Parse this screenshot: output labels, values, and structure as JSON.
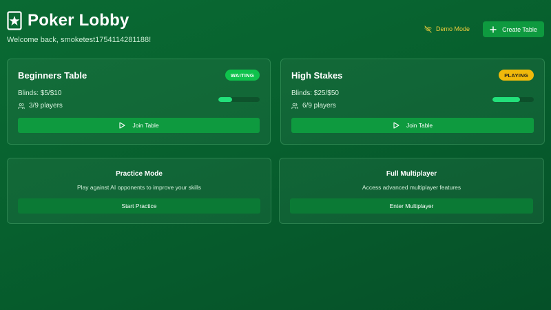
{
  "header": {
    "title": "Poker Lobby",
    "welcome": "Welcome back, smoketest1754114281188!"
  },
  "toolbar": {
    "demo_label": "Demo Mode",
    "create_label": "Create Table"
  },
  "tables": [
    {
      "name": "Beginners Table",
      "status": "WAITING",
      "status_color": "#0fc24c",
      "blinds": "Blinds: $5/$10",
      "players": "3/9 players",
      "fill_fraction": 0.333,
      "join_label": "Join Table"
    },
    {
      "name": "High Stakes",
      "status": "PLAYING",
      "status_color": "#f0b90b",
      "blinds": "Blinds: $25/$50",
      "players": "6/9 players",
      "fill_fraction": 0.667,
      "join_label": "Join Table"
    }
  ],
  "modes": [
    {
      "title": "Practice Mode",
      "description": "Play against AI opponents to improve your skills",
      "button": "Start Practice"
    },
    {
      "title": "Full Multiplayer",
      "description": "Access advanced multiplayer features",
      "button": "Enter Multiplayer"
    }
  ],
  "icons": {
    "logo": "playing-card-star-icon",
    "demo": "wifi-off-icon",
    "create": "plus-icon",
    "players": "users-icon",
    "join": "play-icon"
  },
  "colors": {
    "accent": "#0e9a3f",
    "progress": "#22e07a",
    "demo_text": "#f2cf3c"
  }
}
